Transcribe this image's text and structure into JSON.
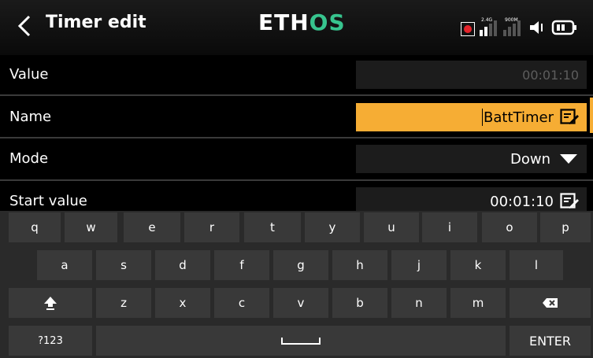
{
  "header": {
    "title": "Timer edit",
    "logo_part1": "ETH",
    "logo_part2": "OS",
    "signal1_label": "2.4G",
    "signal2_label": "900M"
  },
  "form": {
    "rows": [
      {
        "label": "Value",
        "value": "00:01:10"
      },
      {
        "label": "Name",
        "value": "BattTimer"
      },
      {
        "label": "Mode",
        "value": "Down"
      },
      {
        "label": "Start value",
        "value": "00:01:10"
      }
    ]
  },
  "keyboard": {
    "row1": [
      "q",
      "w",
      "e",
      "r",
      "t",
      "y",
      "u",
      "i",
      "o",
      "p"
    ],
    "row2": [
      "a",
      "s",
      "d",
      "f",
      "g",
      "h",
      "j",
      "k",
      "l"
    ],
    "row3": [
      "z",
      "x",
      "c",
      "v",
      "b",
      "n",
      "m"
    ],
    "mode_label": "?123",
    "enter_label": "ENTER"
  },
  "colors": {
    "accent": "#f6ad34",
    "brand_green": "#37c48e",
    "record": "#e5242b"
  }
}
